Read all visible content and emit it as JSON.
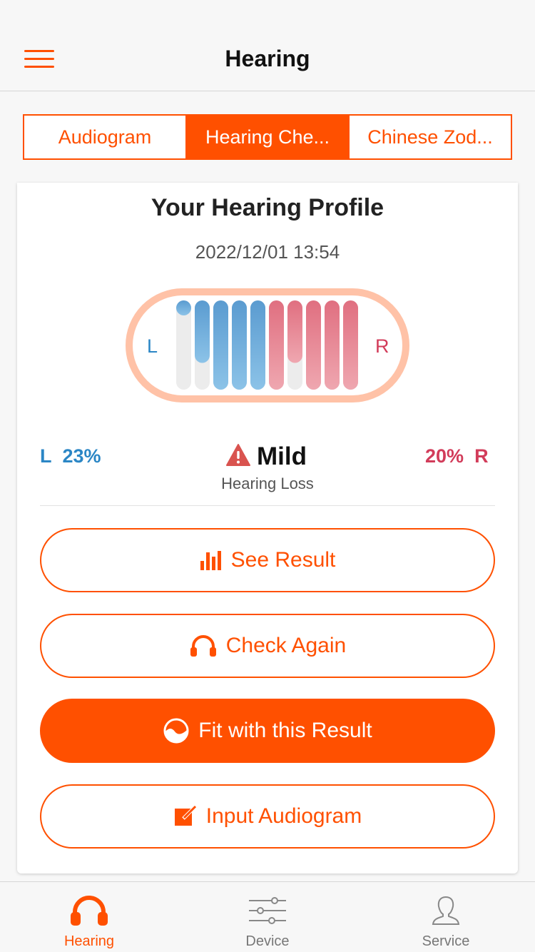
{
  "nav": {
    "title": "Hearing",
    "menu_icon": "hamburger-menu-icon"
  },
  "segments": [
    {
      "label": "Audiogram",
      "active": false
    },
    {
      "label": "Hearing Che...",
      "active": true
    },
    {
      "label": "Chinese Zod...",
      "active": false
    }
  ],
  "profile": {
    "title": "Your Hearing Profile",
    "date": "2022/12/01 13:54",
    "left_label": "L",
    "right_label": "R",
    "left_bars_fill": [
      0.1,
      0.7,
      1.0,
      1.0,
      1.0
    ],
    "right_bars_fill": [
      1.0,
      0.7,
      1.0,
      1.0,
      1.0
    ],
    "left_color": "#5a9fd4",
    "right_color": "#e07686",
    "capsule_color": "#ffc2a7"
  },
  "summary": {
    "left_prefix": "L",
    "left_percent": "23%",
    "right_percent": "20%",
    "right_suffix": "R",
    "level": "Mild",
    "caption": "Hearing Loss",
    "warning_icon": "warning-icon",
    "warning_color": "#d9534f"
  },
  "actions": {
    "see_result": "See Result",
    "check_again": "Check Again",
    "fit_result": "Fit with this Result",
    "input_audiogram": "Input Audiogram"
  },
  "tabbar": [
    {
      "label": "Hearing",
      "icon": "headphones-icon",
      "active": true
    },
    {
      "label": "Device",
      "icon": "sliders-icon",
      "active": false
    },
    {
      "label": "Service",
      "icon": "person-icon",
      "active": false
    }
  ],
  "colors": {
    "accent": "#ff5000",
    "left_ear": "#2b86c5",
    "right_ear": "#d23c5a"
  }
}
